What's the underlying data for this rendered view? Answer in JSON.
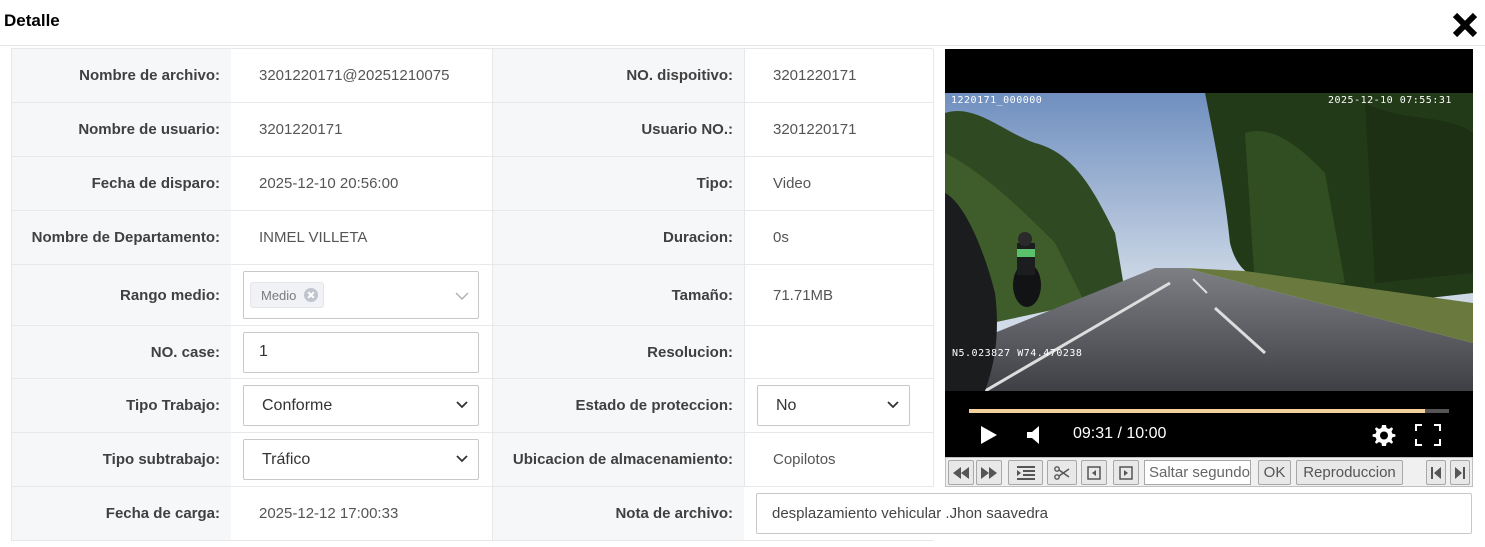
{
  "dialog": {
    "title": "Detalle"
  },
  "fields": {
    "nombre_archivo": {
      "label": "Nombre de archivo:",
      "value": "3201220171@20251210075"
    },
    "no_dispositivo": {
      "label": "NO. dispoitivo:",
      "value": "3201220171"
    },
    "nombre_usuario": {
      "label": "Nombre de usuario:",
      "value": "3201220171"
    },
    "usuario_no": {
      "label": "Usuario NO.:",
      "value": "3201220171"
    },
    "fecha_disparo": {
      "label": "Fecha de disparo:",
      "value": "2025-12-10 20:56:00"
    },
    "tipo": {
      "label": "Tipo:",
      "value": "Video"
    },
    "departamento": {
      "label": "Nombre de Departamento:",
      "value": "INMEL VILLETA"
    },
    "duracion": {
      "label": "Duracion:",
      "value": "0s"
    },
    "rango_medio": {
      "label": "Rango medio:",
      "tag": "Medio"
    },
    "tamano": {
      "label": "Tamaño:",
      "value": "71.71MB"
    },
    "no_case": {
      "label": "NO. case:",
      "value": "1"
    },
    "resolucion": {
      "label": "Resolucion:",
      "value": ""
    },
    "tipo_trabajo": {
      "label": "Tipo Trabajo:",
      "value": "Conforme"
    },
    "estado_proteccion": {
      "label": "Estado de proteccion:",
      "value": "No"
    },
    "tipo_subtrabajo": {
      "label": "Tipo subtrabajo:",
      "value": "Tráfico"
    },
    "ubicacion": {
      "label": "Ubicacion de almacenamiento:",
      "value": "Copilotos"
    },
    "fecha_carga": {
      "label": "Fecha de carga:",
      "value": "2025-12-12 17:00:33"
    },
    "nota_archivo": {
      "label": "Nota de archivo:",
      "value": "desplazamiento vehicular .Jhon saavedra"
    }
  },
  "player": {
    "osd_device": "1220171_000000",
    "osd_datetime": "2025-12-10  07:55:31",
    "osd_gps": "N5.023827  W74.470238",
    "time_display": "09:31 / 10:00",
    "progress": 0.951,
    "icons": [
      "play-icon",
      "volume-icon",
      "settings-gear-icon",
      "fullscreen-icon"
    ]
  },
  "toolbar": {
    "jump_placeholder": "Saltar segundo",
    "ok_label": "OK",
    "playback_label": "Reproduccion",
    "icons": [
      "rewind-icon",
      "fast-forward-icon",
      "playlist-icon",
      "scissors-icon",
      "prev-frame-icon",
      "next-frame-icon",
      "skip-start-icon",
      "skip-end-icon"
    ]
  },
  "colors": {
    "label_bg": "#f6f7f9",
    "progress_fill": "#f3d19e",
    "border": "#e8e8e8"
  }
}
